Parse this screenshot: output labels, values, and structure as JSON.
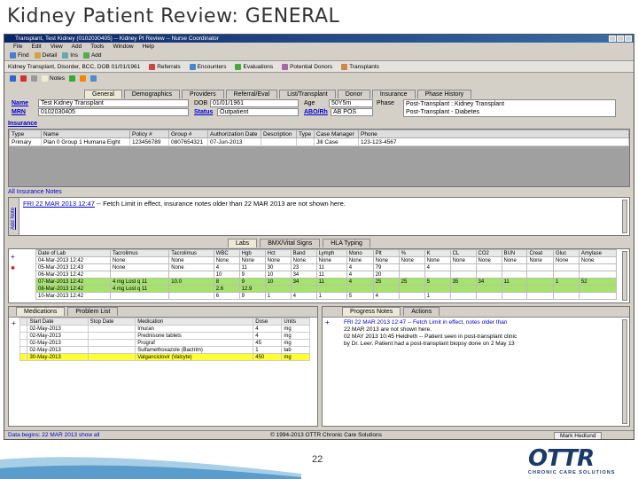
{
  "slide": {
    "title": "Kidney Patient Review:  GENERAL",
    "page_number": "22"
  },
  "window": {
    "title": "Transplant, Test Kidney (0102030405) -- Kidney Pt Review -- Nurse Coordinator",
    "menu": [
      "File",
      "Edit",
      "View",
      "Add",
      "Tools",
      "Window",
      "Help"
    ],
    "toolbar": [
      "Find",
      "Detail",
      "Ins",
      "Add"
    ],
    "nav_label": "Kidney Transplant, Disorder, BCC, DOB 01/01/1961",
    "nav_links": [
      "Referrals",
      "Encounters",
      "Evaluations",
      "Potential Donors",
      "Transplants"
    ],
    "tool2": [
      "Notes"
    ],
    "tabs": [
      "General",
      "Demographics",
      "Providers",
      "Referral/Eval",
      "List/Transplant",
      "Donor",
      "Insurance",
      "Phase History"
    ]
  },
  "patient": {
    "name_label": "Name",
    "name_value": "Test Kidney Transplant",
    "dob_label": "DOB",
    "dob_value": "01/01/1961",
    "age_label": "Age",
    "age_value": "50Y5m",
    "phase_label": "Phase",
    "phase_value1": "Post-Transplant : Kidney Transplant",
    "phase_value2": "Post-Transplant - Diabetes",
    "mrn_label": "MRN",
    "mrn_value": "0102030405",
    "status_label": "Status",
    "status_value": "Outpatient",
    "abo_label": "ABO/Rh",
    "abo_value": "AB POS"
  },
  "insurance": {
    "label": "Insurance",
    "headers": [
      "Type",
      "Name",
      "Policy #",
      "Group #",
      "Authorization Date",
      "Description",
      "Type",
      "Case Manager",
      "Phone"
    ],
    "rows": [
      [
        "Primary",
        "Plan 0 Group 1 Humana Eight",
        "123456789",
        "0807654321",
        "07-Jun-2013",
        "",
        "",
        "Jill Case",
        "123-123-4567"
      ]
    ]
  },
  "ins_notes": {
    "label": "All Insurance Notes",
    "side_label": "Add Note",
    "entry_link": "FRI 22 MAR 2013 12:47",
    "entry_text": "-- Fetch Limit in effect, insurance notes older than 22 MAR 2013 are not shown here."
  },
  "lab_tabs": [
    "Labs",
    "BMX/Vital Signs",
    "HLA Typing"
  ],
  "lab_table": {
    "headers": [
      "Date of Lab",
      "Tacrolimus",
      "Tacrolimus",
      "WBC",
      "Hgb",
      "Hct",
      "Band",
      "Lymph",
      "Mono",
      "Plt",
      "%",
      "K",
      "CL",
      "CO2",
      "BUN",
      "Creat",
      "Gluc",
      "Amylase"
    ],
    "rows": [
      [
        "04-Mar-2013 12:42",
        "None",
        "None",
        "None",
        "None",
        "None",
        "None",
        "None",
        "None",
        "None",
        "None",
        "None",
        "None",
        "None",
        "None",
        "None",
        "None",
        "None"
      ],
      [
        "05-Mar-2013 12:43",
        "None",
        "None",
        "4",
        "11",
        "30",
        "23",
        "11",
        "4",
        "79",
        "",
        "4",
        "",
        "",
        "",
        "",
        "",
        ""
      ],
      [
        "06-Mar-2013 12:42",
        "",
        "",
        "10",
        "9",
        "10",
        "34",
        "11",
        "4",
        "20",
        "",
        "",
        "",
        "",
        "",
        "",
        "",
        ""
      ],
      [
        "07-Mar-2013 12:42",
        "4 mg Lost q 11",
        "10.0",
        "8",
        "9",
        "10",
        "34",
        "11",
        "4",
        "25",
        "25",
        "5",
        "35",
        "34",
        "11",
        "",
        "1",
        "52"
      ],
      [
        "08-Mar-2013 12:42",
        "4 mg Lost q 11",
        "",
        "2.6",
        "12.9",
        "",
        "",
        "",
        "",
        "",
        "",
        "",
        "",
        "",
        "",
        "",
        "",
        ""
      ],
      [
        "10-Mar-2013 12:42",
        "",
        "",
        "6",
        "9",
        "1",
        "4",
        "1",
        "5",
        "4",
        "",
        "1",
        "",
        "",
        "",
        "",
        "",
        ""
      ]
    ]
  },
  "meds": {
    "tabs": [
      "Medications",
      "Problem List"
    ],
    "headers": [
      "",
      "Start Date",
      "Stop Date",
      "Medication",
      "Dose",
      "Units"
    ],
    "rows": [
      [
        "",
        "02-May-2013",
        "",
        "Imuran",
        "4",
        "mg"
      ],
      [
        "",
        "02-May-2013",
        "",
        "Prednisone tablets",
        "4",
        "mg"
      ],
      [
        "",
        "02-May-2013",
        "",
        "Prograf",
        "45",
        "mg"
      ],
      [
        "",
        "02-May-2013",
        "",
        "Sulfamethoxazole (Bactrim)",
        "1",
        "tab"
      ],
      [
        "",
        "30-May-2013",
        "",
        "Valganciclovir (Valcyte)",
        "450",
        "mg"
      ]
    ]
  },
  "progress": {
    "tabs": [
      "Progress Notes",
      "Actions"
    ],
    "line1": "FRI 22 MAR 2013 12:47 -- Fetch Limit in effect, notes older than",
    "line2": "22 MAR 2013 are not shown here.",
    "line3": "02 MAY 2013 10:45 Heldreth -- Patient seen in post-transplant clinic",
    "line4": "by Dr. Leer. Patient had a post-transplant biopsy done on 2 May 13"
  },
  "status": {
    "left": "Data begins: 22 MAR 2013  show all",
    "copyright": "1994-2013 OTTR Chronic Care Solutions",
    "user": "Mark Hedlund"
  },
  "logo": {
    "text": "OTTR",
    "sub": "CHRONIC CARE SOLUTIONS"
  },
  "colors": {
    "highlight_green": "#a6e36a",
    "highlight_yellow": "#ffff33",
    "link_blue": "#0000cc"
  }
}
